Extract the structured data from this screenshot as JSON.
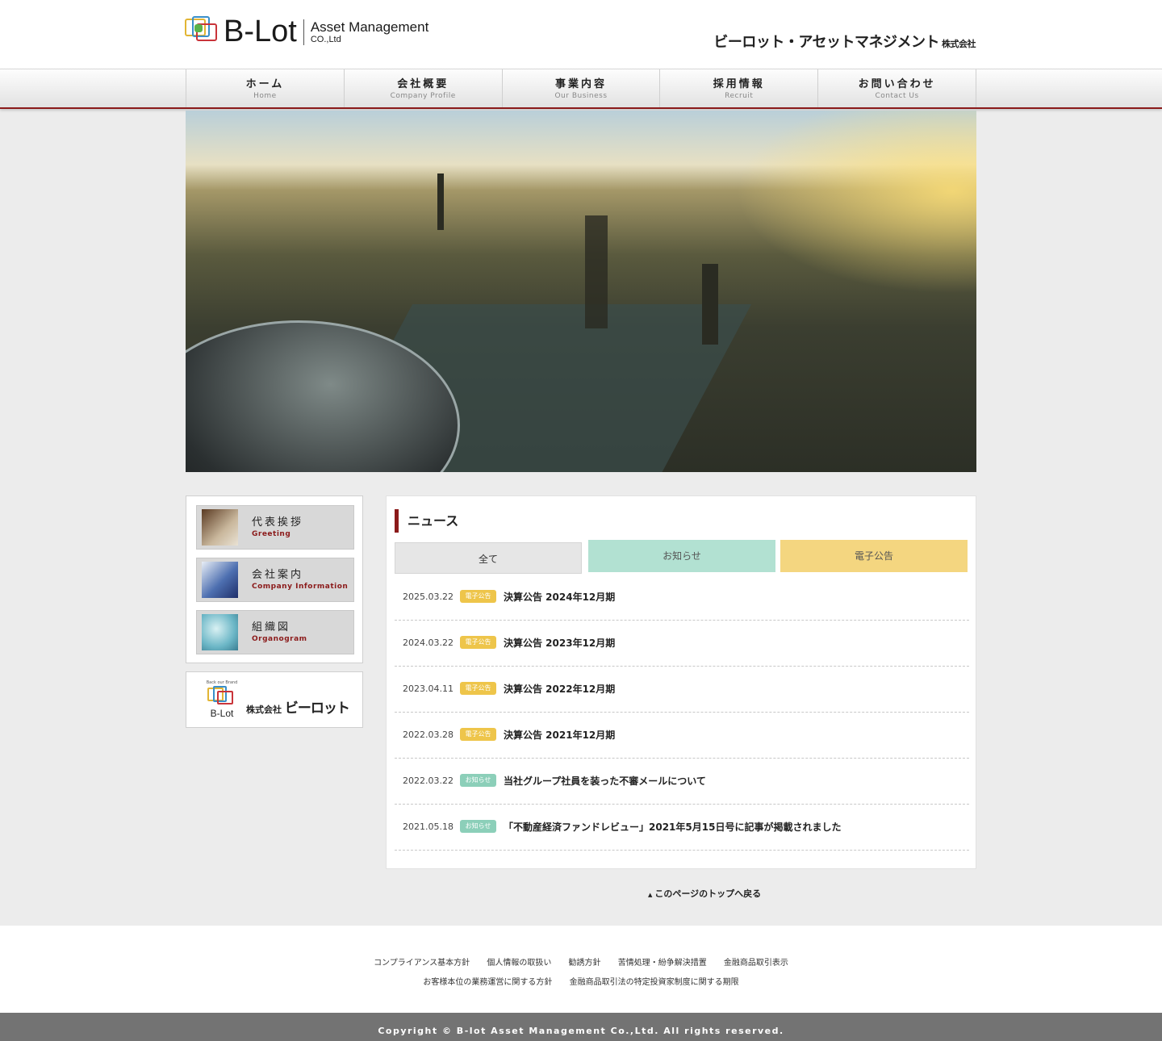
{
  "header": {
    "logo_text": "B-Lot",
    "logo_sub_1": "Asset Management",
    "logo_sub_2": "CO.,Ltd",
    "company_jp": "ビーロット・アセットマネジメント",
    "company_jp_suffix": "株式会社"
  },
  "nav": [
    {
      "jp": "ホーム",
      "en": "Home"
    },
    {
      "jp": "会社概要",
      "en": "Company Profile"
    },
    {
      "jp": "事業内容",
      "en": "Our Business"
    },
    {
      "jp": "採用情報",
      "en": "Recruit"
    },
    {
      "jp": "お問い合わせ",
      "en": "Contact Us"
    }
  ],
  "sidebar": [
    {
      "jp": "代表挨拶",
      "en": "Greeting"
    },
    {
      "jp": "会社案内",
      "en": "Company Information"
    },
    {
      "jp": "組織図",
      "en": "Organogram"
    }
  ],
  "banner": {
    "tiny": "Back our Brand",
    "mark_text": "B-Lot",
    "prefix": "株式会社",
    "name": "ビーロット"
  },
  "news": {
    "title": "ニュース",
    "tabs": {
      "all": "全て",
      "info": "お知らせ",
      "koukoku": "電子公告"
    },
    "items": [
      {
        "date": "2025.03.22",
        "badge": "電子公告",
        "text": "決算公告 2024年12月期"
      },
      {
        "date": "2024.03.22",
        "badge": "電子公告",
        "text": "決算公告 2023年12月期"
      },
      {
        "date": "2023.04.11",
        "badge": "電子公告",
        "text": "決算公告 2022年12月期"
      },
      {
        "date": "2022.03.28",
        "badge": "電子公告",
        "text": "決算公告 2021年12月期"
      },
      {
        "date": "2022.03.22",
        "badge": "お知らせ",
        "text": "当社グループ社員を装った不審メールについて"
      },
      {
        "date": "2021.05.18",
        "badge": "お知らせ",
        "text": "「不動産経済ファンドレビュー」2021年5月15日号に記事が掲載されました"
      }
    ]
  },
  "pagetop": "このページのトップへ戻る",
  "footer": {
    "row1": [
      "コンプライアンス基本方針",
      "個人情報の取扱い",
      "勧誘方針",
      "苦情処理・紛争解決措置",
      "金融商品取引表示"
    ],
    "row2": [
      "お客様本位の業務運営に関する方針",
      "金融商品取引法の特定投資家制度に関する期限"
    ],
    "copyright": "Copyright © B-lot Asset Management Co.,Ltd. All rights reserved."
  },
  "colors": {
    "accent": "#8b1a1a",
    "info_tab": "#b2e1d2",
    "koukoku_tab": "#f4d680"
  }
}
